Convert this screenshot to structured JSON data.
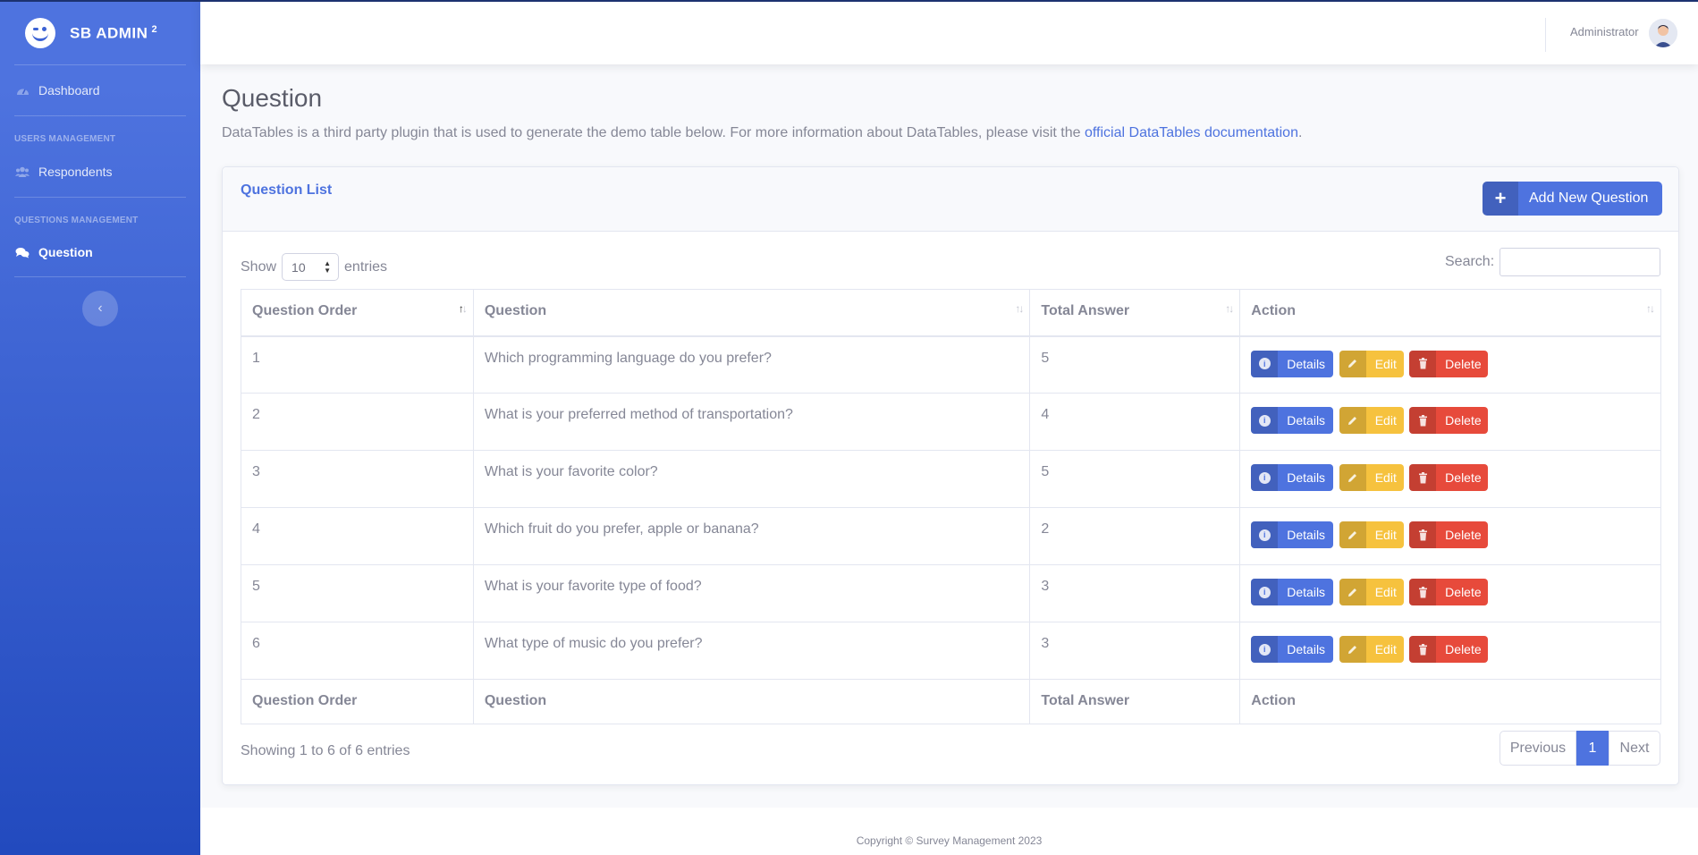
{
  "brand": {
    "name": "SB ADMIN",
    "sup": "2"
  },
  "sidebar": {
    "dashboard": "Dashboard",
    "heading_users": "USERS MANAGEMENT",
    "respondents": "Respondents",
    "heading_questions": "QUESTIONS MANAGEMENT",
    "question": "Question"
  },
  "topbar": {
    "user": "Administrator"
  },
  "page": {
    "title": "Question",
    "desc_prefix": "DataTables is a third party plugin that is used to generate the demo table below. For more information about DataTables, please visit the ",
    "desc_link": "official DataTables documentation",
    "desc_suffix": "."
  },
  "card": {
    "title": "Question List",
    "add_button": "Add New Question"
  },
  "table_controls": {
    "show_label": "Show",
    "entries_value": "10",
    "entries_label": "entries",
    "search_label": "Search:"
  },
  "table": {
    "headers": [
      "Question Order",
      "Question",
      "Total Answer",
      "Action"
    ],
    "rows": [
      {
        "order": "1",
        "question": "Which programming language do you prefer?",
        "total": "5"
      },
      {
        "order": "2",
        "question": "What is your preferred method of transportation?",
        "total": "4"
      },
      {
        "order": "3",
        "question": "What is your favorite color?",
        "total": "5"
      },
      {
        "order": "4",
        "question": "Which fruit do you prefer, apple or banana?",
        "total": "2"
      },
      {
        "order": "5",
        "question": "What is your favorite type of food?",
        "total": "3"
      },
      {
        "order": "6",
        "question": "What type of music do you prefer?",
        "total": "3"
      }
    ],
    "actions": {
      "details": "Details",
      "edit": "Edit",
      "delete": "Delete"
    }
  },
  "pagination": {
    "info": "Showing 1 to 6 of 6 entries",
    "previous": "Previous",
    "current": "1",
    "next": "Next"
  },
  "footer": {
    "text": "Copyright © Survey Management 2023"
  },
  "colors": {
    "primary": "#4e73df",
    "warning": "#f6c23e",
    "danger": "#e74a3b"
  }
}
